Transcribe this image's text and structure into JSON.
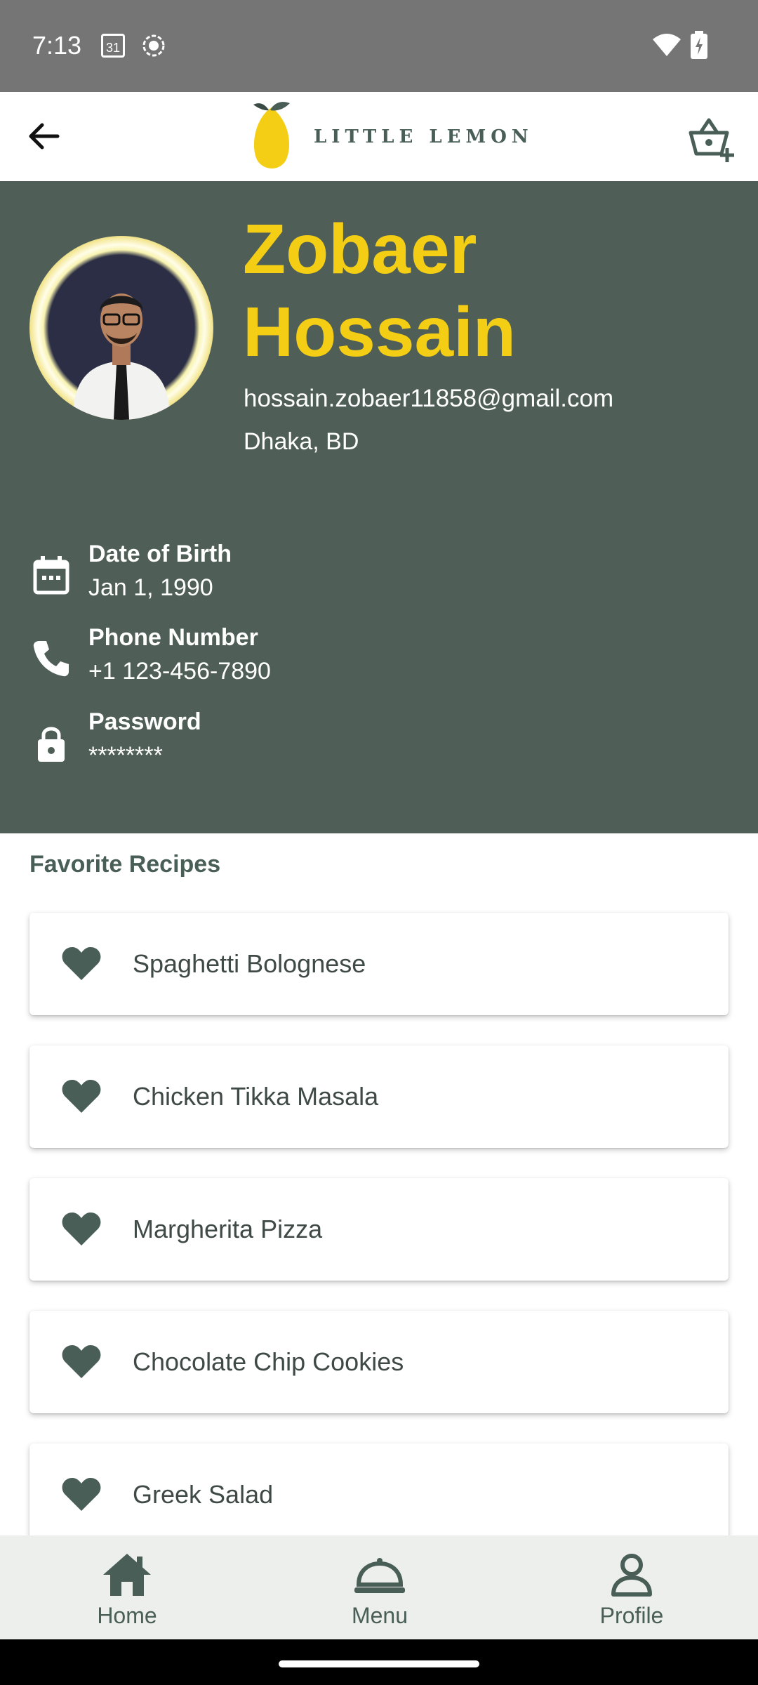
{
  "status_bar": {
    "time": "7:13",
    "calendar_day": "31"
  },
  "app_bar": {
    "logo_text": "LITTLE LEMON"
  },
  "profile": {
    "name": "Zobaer Hossain",
    "email": "hossain.zobaer11858@gmail.com",
    "location": "Dhaka, BD",
    "details": [
      {
        "label": "Date of Birth",
        "value": "Jan 1, 1990",
        "icon": "calendar-icon"
      },
      {
        "label": "Phone Number",
        "value": "+1 123-456-7890",
        "icon": "phone-icon"
      },
      {
        "label": "Password",
        "value": "********",
        "icon": "lock-icon"
      }
    ]
  },
  "favorites": {
    "title": "Favorite Recipes",
    "items": [
      {
        "name": "Spaghetti Bolognese"
      },
      {
        "name": "Chicken Tikka Masala"
      },
      {
        "name": "Margherita Pizza"
      },
      {
        "name": "Chocolate Chip Cookies"
      },
      {
        "name": "Greek Salad"
      }
    ]
  },
  "bottom_nav": {
    "items": [
      {
        "label": "Home",
        "icon": "home-icon"
      },
      {
        "label": "Menu",
        "icon": "cloche-icon"
      },
      {
        "label": "Profile",
        "icon": "person-icon"
      }
    ]
  },
  "colors": {
    "primary": "#495E57",
    "accent": "#F4CE14",
    "panel": "#4f5f58"
  }
}
